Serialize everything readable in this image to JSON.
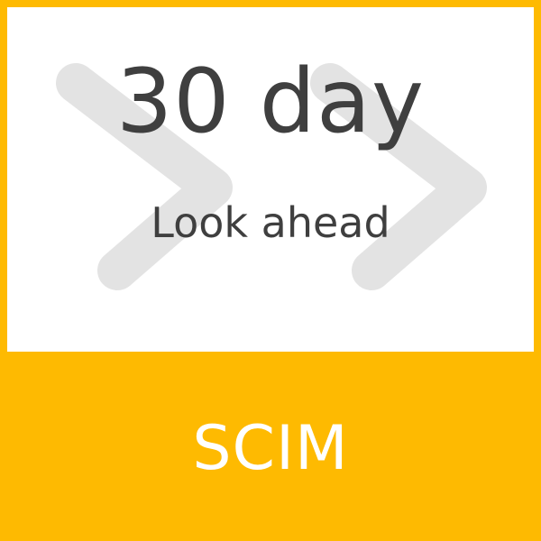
{
  "tile": {
    "headline": "30 day",
    "subline": "Look ahead",
    "footer_label": "SCIM"
  },
  "colors": {
    "accent": "#FEBA01",
    "panel": "#FFFFFF",
    "text": "#3F3F3F",
    "chevron": "#E3E3E3",
    "footer_text": "#FFFFFF"
  },
  "icons": {
    "background": "double-chevron-right-icon"
  }
}
